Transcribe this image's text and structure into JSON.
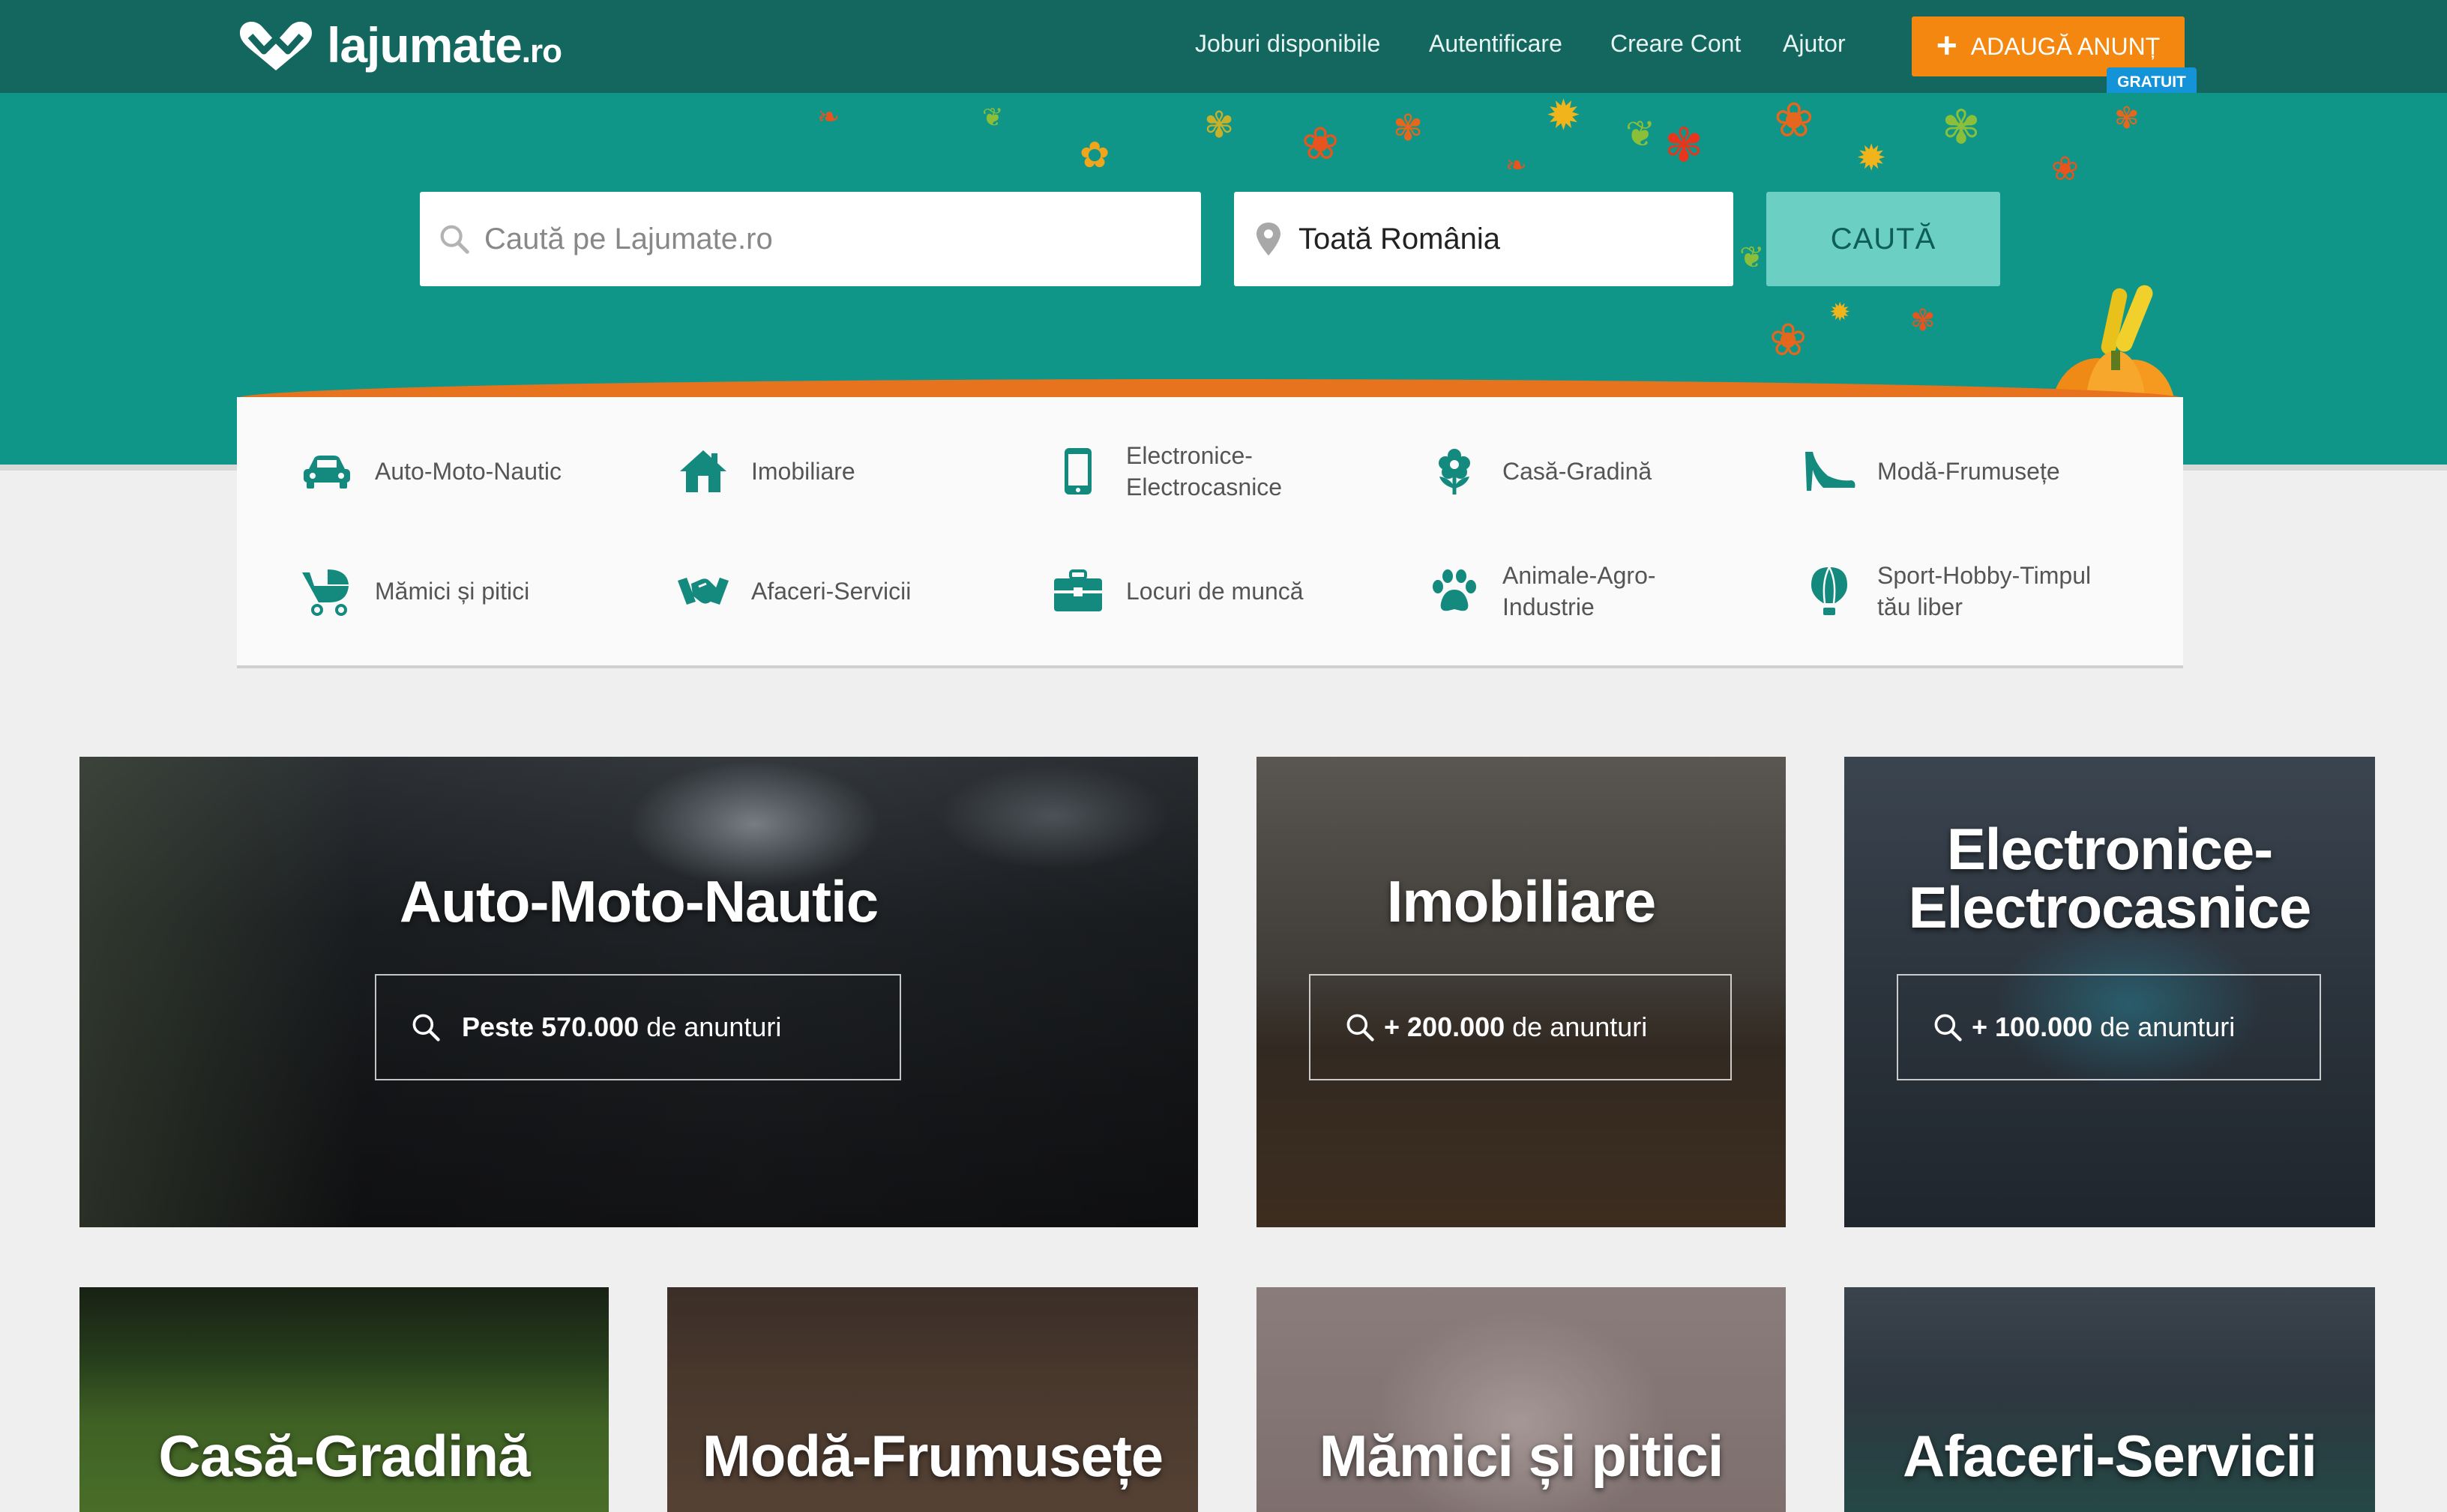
{
  "header": {
    "logo_text": "lajumate",
    "logo_tld": ".ro",
    "nav": [
      {
        "label": "Joburi disponibile"
      },
      {
        "label": "Autentificare"
      },
      {
        "label": "Creare Cont"
      },
      {
        "label": "Ajutor"
      }
    ],
    "add_button": "ADAUGĂ ANUNȚ",
    "add_badge": "GRATUIT",
    "brand_color": "#14675f",
    "accent_color": "#f4870f"
  },
  "search": {
    "placeholder": "Caută pe Lajumate.ro",
    "location_value": "Toată România",
    "button_label": "CAUTĂ",
    "search_icon": "search-icon",
    "location_icon": "map-pin-icon"
  },
  "categories": [
    {
      "label": "Auto-Moto-Nautic",
      "icon": "car-icon"
    },
    {
      "label": "Imobiliare",
      "icon": "house-icon"
    },
    {
      "label": "Electronice-\nElectrocasnice",
      "icon": "phone-icon"
    },
    {
      "label": "Casă-Gradină",
      "icon": "flower-icon"
    },
    {
      "label": "Modă-Frumusețe",
      "icon": "high-heel-icon"
    },
    {
      "label": "Mămici și pitici",
      "icon": "stroller-icon"
    },
    {
      "label": "Afaceri-Servicii",
      "icon": "handshake-icon"
    },
    {
      "label": "Locuri de muncă",
      "icon": "briefcase-icon"
    },
    {
      "label": "Animale-Agro-\nIndustrie",
      "icon": "paw-icon"
    },
    {
      "label": "Sport-Hobby-Timpul\ntău liber",
      "icon": "balloon-icon"
    }
  ],
  "tiles": [
    {
      "title": "Auto-Moto-Nautic",
      "count_bold": "Peste 570.000",
      "count_rest": "de anunturi"
    },
    {
      "title": "Imobiliare",
      "count_bold": "+ 200.000",
      "count_rest": "de anunturi"
    },
    {
      "title": "Electronice-\nElectrocasnice",
      "count_bold": "+ 100.000",
      "count_rest": "de anunturi"
    },
    {
      "title": "Casă-Gradină"
    },
    {
      "title": "Modă-Frumusețe"
    },
    {
      "title": "Mămici și pitici"
    },
    {
      "title": "Afaceri-Servicii"
    }
  ]
}
